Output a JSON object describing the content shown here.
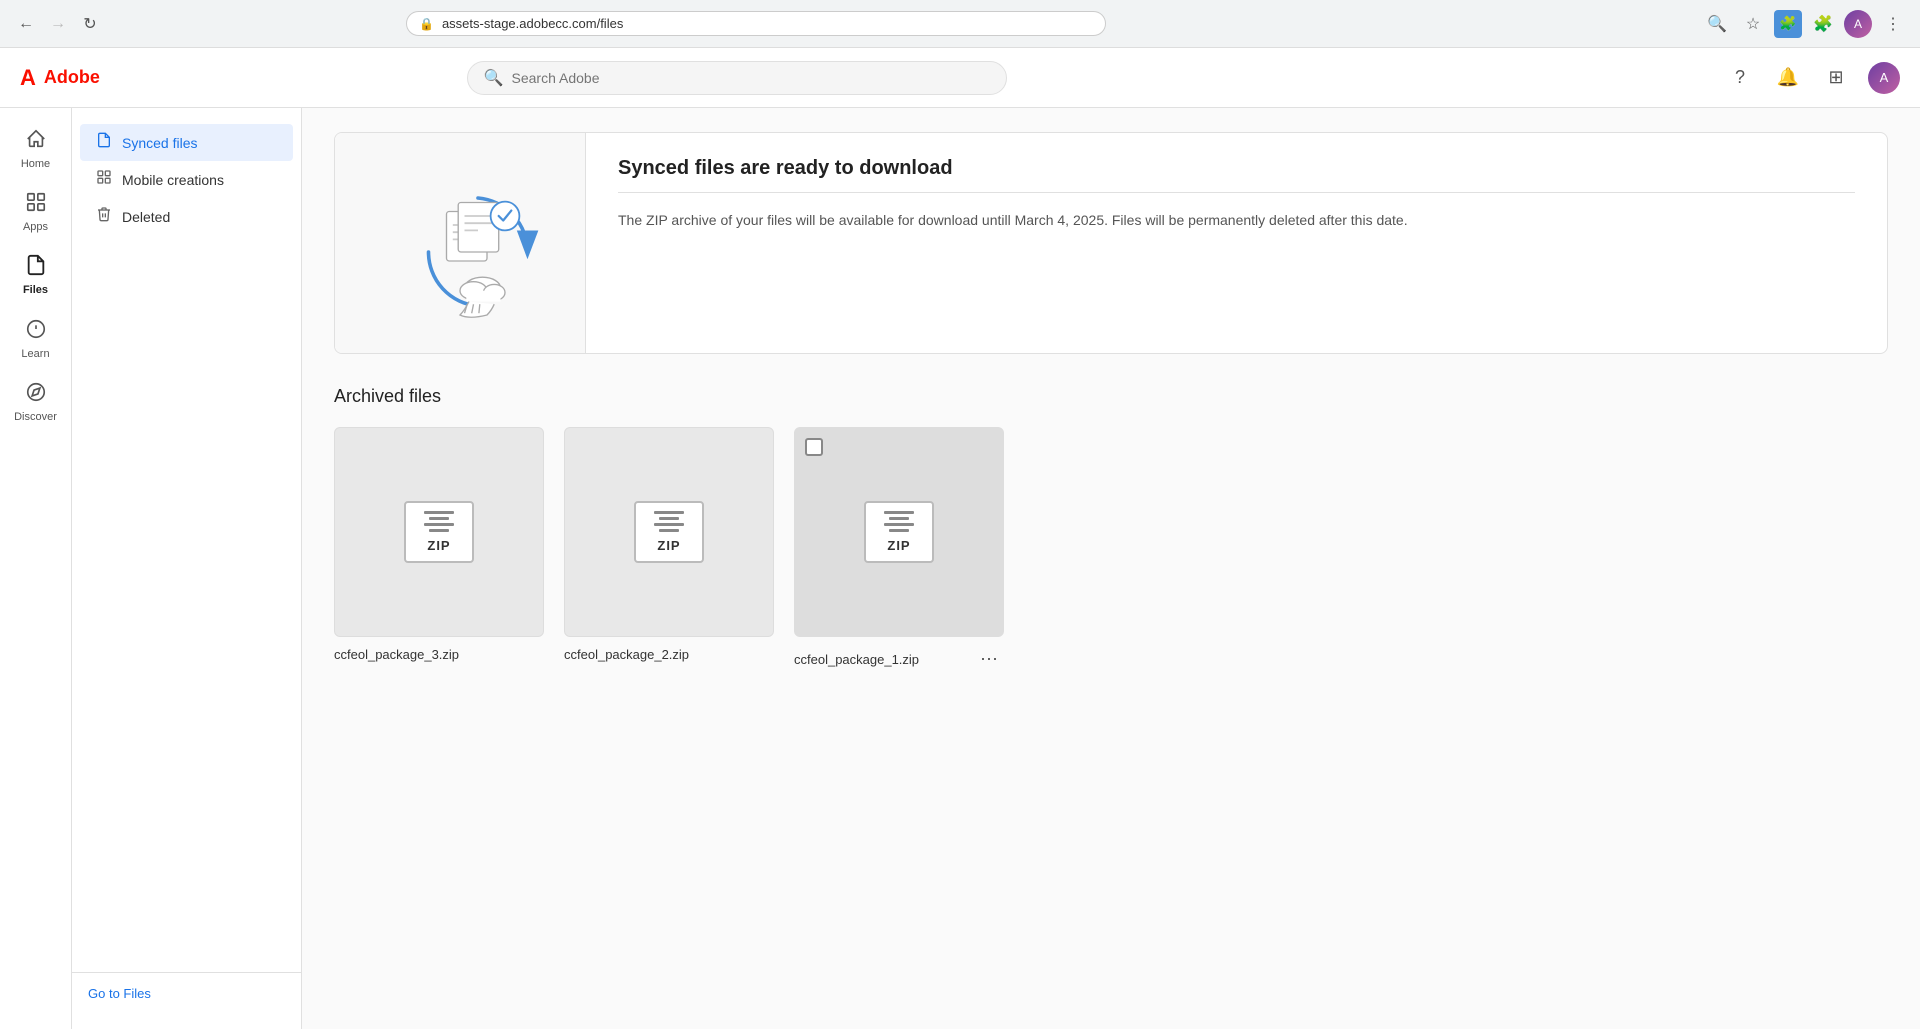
{
  "browser": {
    "url": "assets-stage.adobecc.com/files",
    "back_disabled": false,
    "forward_disabled": true
  },
  "topbar": {
    "logo_text": "Adobe",
    "search_placeholder": "Search Adobe",
    "help_icon": "?",
    "notification_icon": "🔔",
    "apps_icon": "⊞"
  },
  "left_nav": {
    "items": [
      {
        "id": "home",
        "label": "Home",
        "icon": "⌂",
        "active": false
      },
      {
        "id": "apps",
        "label": "Apps",
        "icon": "⊞",
        "active": false
      },
      {
        "id": "files",
        "label": "Files",
        "icon": "📄",
        "active": true
      },
      {
        "id": "learn",
        "label": "Learn",
        "icon": "💡",
        "active": false
      },
      {
        "id": "discover",
        "label": "Discover",
        "icon": "◎",
        "active": false
      }
    ]
  },
  "sidebar": {
    "items": [
      {
        "id": "synced-files",
        "label": "Synced files",
        "icon": "📄",
        "active": true
      },
      {
        "id": "mobile-creations",
        "label": "Mobile creations",
        "icon": "⊞",
        "active": false
      },
      {
        "id": "deleted",
        "label": "Deleted",
        "icon": "🗑",
        "active": false
      }
    ],
    "footer_link": "Go to Files"
  },
  "banner": {
    "title": "Synced files are ready to download",
    "description": "The ZIP archive of your files will be available for download untill March 4, 2025. Files will be permanently deleted after this date."
  },
  "archived_files": {
    "section_title": "Archived files",
    "files": [
      {
        "id": "file-3",
        "name": "ccfeol_package_3.zip",
        "selected": false,
        "show_checkbox": false,
        "show_more": false
      },
      {
        "id": "file-2",
        "name": "ccfeol_package_2.zip",
        "selected": false,
        "show_checkbox": false,
        "show_more": false
      },
      {
        "id": "file-1",
        "name": "ccfeol_package_1.zip",
        "selected": false,
        "show_checkbox": true,
        "show_more": true
      }
    ]
  }
}
